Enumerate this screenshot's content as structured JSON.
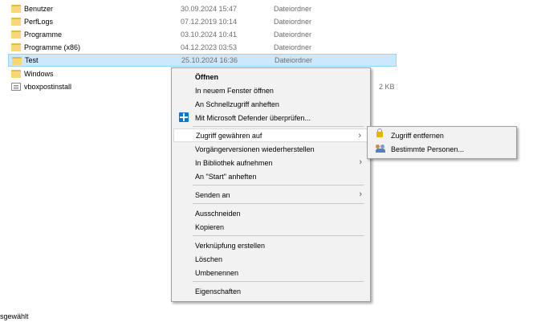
{
  "files": [
    {
      "name": "Benutzer",
      "date": "30.09.2024 15:47",
      "type": "Dateiordner",
      "size": "",
      "icon": "folder-icon"
    },
    {
      "name": "PerfLogs",
      "date": "07.12.2019 10:14",
      "type": "Dateiordner",
      "size": "",
      "icon": "folder-icon"
    },
    {
      "name": "Programme",
      "date": "03.10.2024 10:41",
      "type": "Dateiordner",
      "size": "",
      "icon": "folder-icon"
    },
    {
      "name": "Programme (x86)",
      "date": "04.12.2023 03:53",
      "type": "Dateiordner",
      "size": "",
      "icon": "folder-icon"
    },
    {
      "name": "Test",
      "date": "25.10.2024 16:36",
      "type": "Dateiordner",
      "size": "",
      "icon": "folder-icon",
      "selected": true
    },
    {
      "name": "Windows",
      "date": "",
      "type": "",
      "size": "",
      "icon": "folder-icon"
    },
    {
      "name": "vboxpostinstall",
      "date": "",
      "type": "",
      "size": "2 KB",
      "icon": "document-icon"
    }
  ],
  "context_menu": {
    "open": "Öffnen",
    "open_new_window": "In neuem Fenster öffnen",
    "pin_quick_access": "An Schnellzugriff anheften",
    "defender_scan": "Mit Microsoft Defender überprüfen...",
    "give_access": "Zugriff gewähren auf",
    "restore_versions": "Vorgängerversionen wiederherstellen",
    "include_library": "In Bibliothek aufnehmen",
    "pin_start": "An \"Start\" anheften",
    "send_to": "Senden an",
    "cut": "Ausschneiden",
    "copy": "Kopieren",
    "create_shortcut": "Verknüpfung erstellen",
    "delete": "Löschen",
    "rename": "Umbenennen",
    "properties": "Eigenschaften"
  },
  "submenu": {
    "remove_access": "Zugriff entfernen",
    "specific_people": "Bestimmte Personen..."
  },
  "status_bar": {
    "text": "sgewählt"
  },
  "colors": {
    "selection_bg": "#cce8ff",
    "selection_border": "#99d1ff",
    "menu_bg": "#f2f2f2",
    "folder": "#f8d775",
    "defender": "#0078d7"
  }
}
